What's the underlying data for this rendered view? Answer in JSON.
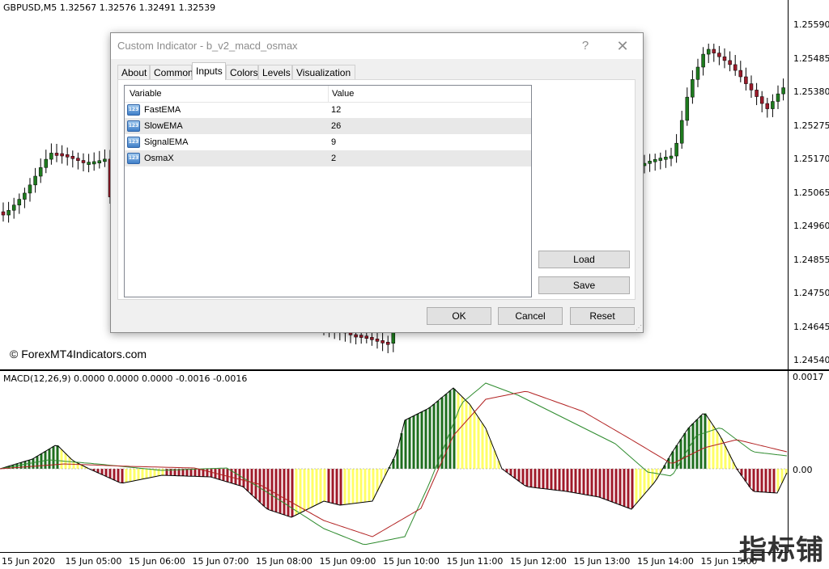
{
  "price_chart": {
    "title": "GBPUSD,M5  1.32567 1.32576 1.32491 1.32539",
    "price_labels": [
      "1.25590",
      "1.25485",
      "1.25380",
      "1.25275",
      "1.25170",
      "1.25065",
      "1.24960",
      "1.24855",
      "1.24750",
      "1.24645",
      "1.24540"
    ],
    "watermark": "© ForexMT4Indicators.com"
  },
  "macd_chart": {
    "title": "MACD(12,26,9) 0.0000 0.0000 0.0000 -0.0016 -0.0016",
    "axis_labels": [
      "0.0017",
      "0.00"
    ]
  },
  "time_axis": [
    "15 Jun 2020",
    "15 Jun 05:00",
    "15 Jun 06:00",
    "15 Jun 07:00",
    "15 Jun 08:00",
    "15 Jun 09:00",
    "15 Jun 10:00",
    "15 Jun 11:00",
    "15 Jun 12:00",
    "15 Jun 13:00",
    "15 Jun 14:00",
    "15 Jun 15:00"
  ],
  "brand": "指标铺",
  "colors": {
    "bull_candle": "#1e7a1e",
    "bear_candle": "#9b1b2a",
    "hist_green": "#1e6e1e",
    "hist_yellow": "#ffff66",
    "hist_red": "#a01a2a",
    "macd_line": "#2e8b2e",
    "signal_line": "#b22222"
  },
  "dialog": {
    "title": "Custom Indicator - b_v2_macd_osmax",
    "help": "?",
    "close": "✕",
    "tabs": [
      "About",
      "Common",
      "Inputs",
      "Colors",
      "Levels",
      "Visualization"
    ],
    "active_tab": "Inputs",
    "columns": [
      "Variable",
      "Value"
    ],
    "rows": [
      {
        "icon": "123",
        "variable": "FastEMA",
        "value": "12"
      },
      {
        "icon": "123",
        "variable": "SlowEMA",
        "value": "26"
      },
      {
        "icon": "123",
        "variable": "SignalEMA",
        "value": "9"
      },
      {
        "icon": "123",
        "variable": "OsmaX",
        "value": "2"
      }
    ],
    "load_label": "Load",
    "save_label": "Save",
    "ok_label": "OK",
    "cancel_label": "Cancel",
    "reset_label": "Reset"
  }
}
